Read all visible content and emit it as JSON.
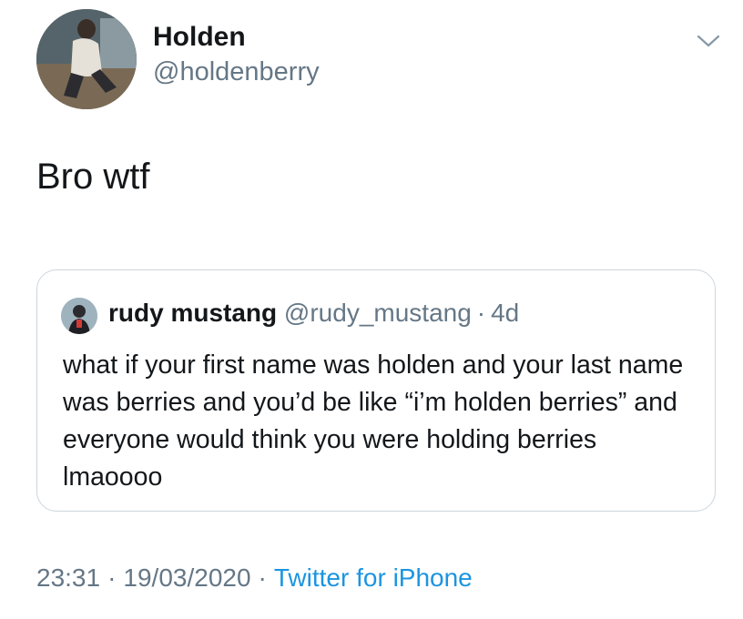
{
  "tweet": {
    "author": {
      "display_name": "Holden",
      "handle": "@holdenberry",
      "avatar_icon": "profile-photo"
    },
    "menu_icon": "chevron-down-icon",
    "text": "Bro wtf",
    "quoted": {
      "display_name": "rudy mustang",
      "handle": "@rudy_mustang",
      "separator": "·",
      "age": "4d",
      "avatar_icon": "profile-photo",
      "text": "what if your first name was holden and your last name was berries and you’d be like “i’m holden berries” and everyone would think you were holding berries lmaoooo"
    },
    "meta": {
      "time": "23:31",
      "separator": "·",
      "date": "19/03/2020",
      "source": "Twitter for iPhone"
    }
  },
  "colors": {
    "text_primary": "#14171a",
    "text_secondary": "#657786",
    "link": "#1b95e0",
    "border": "#ccd6dd",
    "background": "#ffffff"
  }
}
